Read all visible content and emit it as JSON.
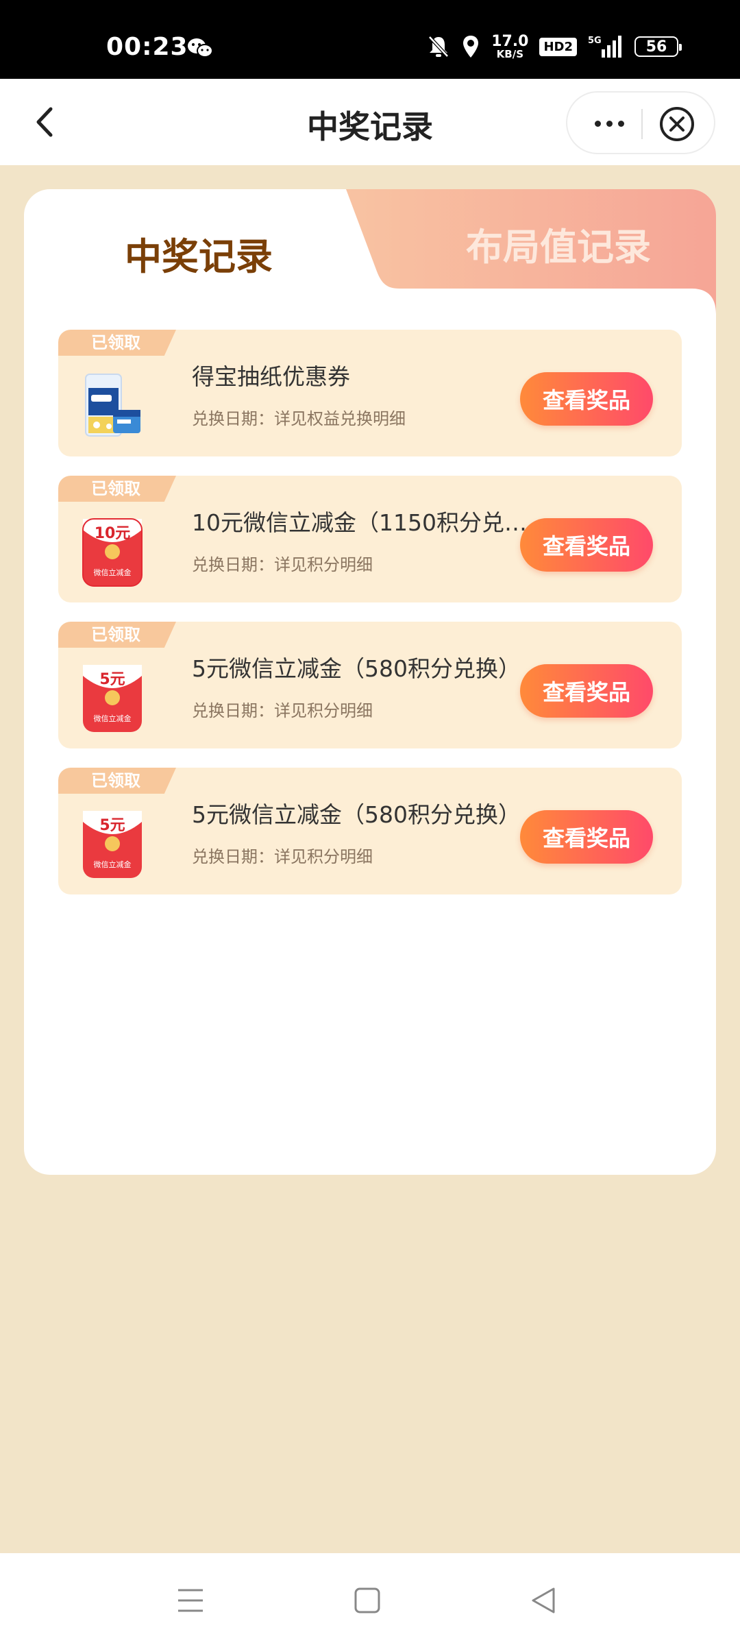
{
  "status_bar": {
    "time": "00:23",
    "net_speed_value": "17.0",
    "net_speed_unit": "KB/S",
    "hd_label": "HD2",
    "network_label": "5G",
    "battery": "56",
    "icons": [
      "wechat-icon",
      "mute-bell-icon",
      "location-icon",
      "signal-icon"
    ]
  },
  "nav": {
    "title": "中奖记录",
    "icons": [
      "back-arrow-icon",
      "more-dots-icon",
      "close-circle-icon"
    ]
  },
  "tabs": [
    {
      "label": "中奖记录",
      "active": true
    },
    {
      "label": "布局值记录",
      "active": false
    }
  ],
  "records": [
    {
      "tag": "已领取",
      "name": "得宝抽纸优惠券",
      "date": "兑换日期：详见权益兑换明细",
      "button": "查看奖品",
      "icon": "tissue-pack-icon"
    },
    {
      "tag": "已领取",
      "name": "10元微信立减金（1150积分兑…",
      "date": "兑换日期：详见积分明细",
      "button": "查看奖品",
      "icon": "red-envelope-icon",
      "coupon_value": "10元",
      "coupon_label": "微信立减金"
    },
    {
      "tag": "已领取",
      "name": "5元微信立减金（580积分兑换）",
      "date": "兑换日期：详见积分明细",
      "button": "查看奖品",
      "icon": "red-envelope-icon",
      "coupon_value": "5元",
      "coupon_label": "微信立减金"
    },
    {
      "tag": "已领取",
      "name": "5元微信立减金（580积分兑换）",
      "date": "兑换日期：详见积分明细",
      "button": "查看奖品",
      "icon": "red-envelope-icon",
      "coupon_value": "5元",
      "coupon_label": "微信立减金"
    }
  ],
  "colors": {
    "page_bg": "#f2e4c8",
    "card_item_bg": "#fdeed5",
    "tab_active_text": "#7a3f07",
    "button_gradient_start": "#ff8a3a",
    "button_gradient_end": "#ff4a6a"
  },
  "system_nav": {
    "icons": [
      "menu-icon",
      "home-square-icon",
      "back-triangle-icon"
    ]
  }
}
